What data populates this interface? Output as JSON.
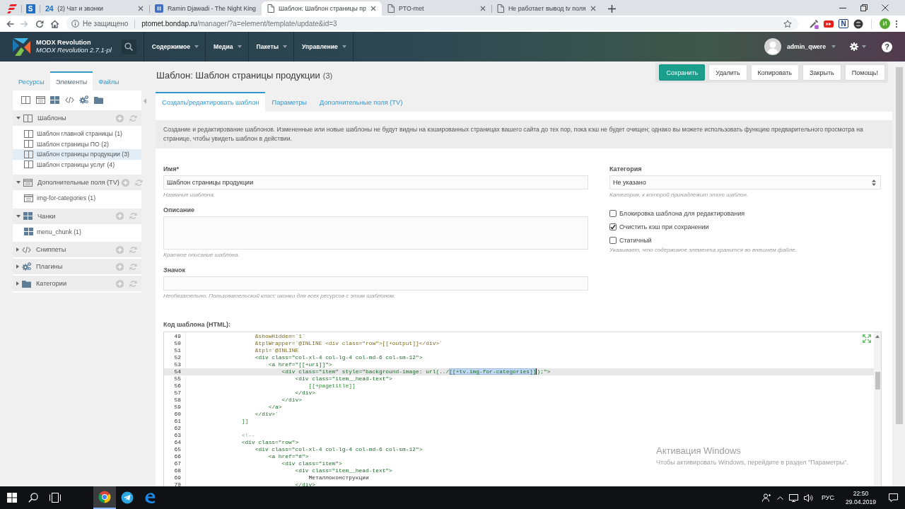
{
  "browser": {
    "tabs": [
      {
        "kind": "logo",
        "selected": false
      },
      {
        "kind": "letter",
        "icon_text": "S",
        "selected": false
      },
      {
        "kind": "counter",
        "icon_text": "24",
        "title": "(2) Чат и звонки",
        "selected": false
      },
      {
        "kind": "media",
        "title": "Ramin Djawadi - The Night King",
        "selected": false
      },
      {
        "kind": "page",
        "title": "Шаблон: Шаблон страницы пр",
        "selected": true
      },
      {
        "kind": "page",
        "title": "PTO-met",
        "selected": false
      },
      {
        "kind": "page",
        "title": "Не работает вывод tv поля",
        "selected": false
      }
    ],
    "security_label": "Не защищено",
    "url": "ptomet.bondap.ru/manager/?a=element/template/update&id=3",
    "extension_letter": "N",
    "profile_initial": "И"
  },
  "modx": {
    "brand": "MODX Revolution",
    "version": "MODX Revolution 2.7.1-pl",
    "menu": [
      "Содержимое",
      "Медиа",
      "Пакеты",
      "Управление"
    ],
    "user": "admin_qwere",
    "help": "?"
  },
  "sidebar": {
    "tabs": [
      {
        "label": "Ресурсы",
        "selected": false
      },
      {
        "label": "Элементы",
        "selected": true
      },
      {
        "label": "Файлы",
        "selected": false
      }
    ],
    "sections": [
      {
        "kind": "templates",
        "label": "Шаблоны",
        "expanded": true,
        "children": [
          {
            "label": "Шаблон главной страницы (1)",
            "selected": false
          },
          {
            "label": "Шаблон страницы ПО (2)",
            "selected": false
          },
          {
            "label": "Шаблон страницы продукции (3)",
            "selected": true
          },
          {
            "label": "Шаблон страницы услуг (4)",
            "selected": false
          }
        ]
      },
      {
        "kind": "tvs",
        "label": "Дополнительные поля (TV)",
        "expanded": true,
        "children": [
          {
            "label": "img-for-categories (1)",
            "selected": false
          }
        ]
      },
      {
        "kind": "chunks",
        "label": "Чанки",
        "expanded": true,
        "children": [
          {
            "label": "menu_chunk (1)",
            "selected": false
          }
        ]
      },
      {
        "kind": "snippets",
        "label": "Сниппеты",
        "expanded": false
      },
      {
        "kind": "plugins",
        "label": "Плагины",
        "expanded": false
      },
      {
        "kind": "categories",
        "label": "Категории",
        "expanded": false
      }
    ]
  },
  "page": {
    "title": "Шаблон: Шаблон страницы продукции",
    "count": "(3)",
    "actions": [
      {
        "kind": "primary",
        "label": "Сохранить"
      },
      {
        "kind": "default",
        "label": "Удалить"
      },
      {
        "kind": "default",
        "label": "Копировать"
      },
      {
        "kind": "default",
        "label": "Закрыть"
      },
      {
        "kind": "default",
        "label": "Помощь!"
      }
    ],
    "tabs": [
      {
        "label": "Создать/редактировать шаблон",
        "selected": true
      },
      {
        "label": "Параметры",
        "selected": false
      },
      {
        "label": "Дополнительные поля (TV)",
        "selected": false
      }
    ],
    "intro": "Создание и редактирование шаблонов. Измененные или новые шаблоны не будут видны на кэшированных страницах вашего сайта до тех пор, пока кэш не будет очищен; однако вы можете использовать функцию предварительного просмотра на странице, чтобы увидеть шаблон в действии.",
    "fields": [
      {
        "kind": "input",
        "label": "Имя*",
        "value": "Шаблон страницы продукции",
        "hint": "Название шаблона."
      },
      {
        "kind": "textarea",
        "label": "Описание",
        "hint": "Краткое описание шаблона."
      },
      {
        "kind": "input",
        "label": "Значок",
        "hint": "Необязательно. Пользовательский класс иконки для всех ресурсов с этим шаблоном."
      }
    ],
    "category": {
      "label": "Категория",
      "value": "Не указано",
      "hint": "Категория, к которой принадлежит этот шаблон."
    },
    "options": [
      {
        "label": "Блокировка шаблона для редактирования",
        "checked": false
      },
      {
        "label": "Очистить кэш при сохранении",
        "checked": true
      },
      {
        "label": "Статичный",
        "checked": false
      }
    ],
    "options_hint": "Указывает, что содержимое элемента хранится во внешнем файле.",
    "code": {
      "label": "Код шаблона (HTML):",
      "lines": [
        {
          "number": "49",
          "kind": "param",
          "text": "                    &showHidden=`1`",
          "active": false
        },
        {
          "number": "50",
          "kind": "param",
          "text": "                    &tplWrapper=`@INLINE <div class=\"row\">[[+output]]</div>`",
          "active": false
        },
        {
          "number": "51",
          "kind": "param",
          "text": "                    &tpl=`@INLINE",
          "active": false
        },
        {
          "number": "52",
          "kind": "tag",
          "text": "                    <div class=\"col-xl-4 col-lg-4 col-md-6 col-sm-12\">",
          "active": false
        },
        {
          "number": "53",
          "kind": "tag",
          "text": "                        <a href=\"[[+uri]]\">",
          "active": false
        },
        {
          "number": "54",
          "kind": "tag",
          "text": "                            <div class=\"item\" style=\"background-image: url(../",
          "selection": "[[+tv.img-for-categories]]",
          "text_after": ");\">",
          "active": true
        },
        {
          "number": "55",
          "kind": "tag",
          "text": "                                <div class=\"item__head-text\">",
          "active": false
        },
        {
          "number": "56",
          "kind": "placeholder",
          "text": "                                    [[+pagetitle]]",
          "active": false
        },
        {
          "number": "57",
          "kind": "tag",
          "text": "                                </div>",
          "active": false
        },
        {
          "number": "58",
          "kind": "tag",
          "text": "                            </div>",
          "active": false
        },
        {
          "number": "59",
          "kind": "tag",
          "text": "                        </a>",
          "active": false
        },
        {
          "number": "60",
          "kind": "tag",
          "text": "                    </div>`",
          "active": false
        },
        {
          "number": "61",
          "kind": "placeholder",
          "text": "                ]]",
          "active": false
        },
        {
          "number": "62",
          "kind": "text",
          "active": false
        },
        {
          "number": "63",
          "kind": "comment",
          "text": "                <!--",
          "active": false
        },
        {
          "number": "64",
          "kind": "tag",
          "text": "                <div class=\"row\">",
          "active": false
        },
        {
          "number": "65",
          "kind": "tag",
          "text": "                    <div class=\"col-xl-4 col-lg-4 col-md-6 col-sm-12\">",
          "active": false
        },
        {
          "number": "66",
          "kind": "tag",
          "text": "                        <a href=\"#\">",
          "active": false
        },
        {
          "number": "67",
          "kind": "tag",
          "text": "                            <div class=\"item\">",
          "active": false
        },
        {
          "number": "68",
          "kind": "tag",
          "text": "                                <div class=\"item__head-text\">",
          "active": false
        },
        {
          "number": "69",
          "kind": "text",
          "text": "                                    Металлоконструкции",
          "active": false
        },
        {
          "number": "70",
          "kind": "tag",
          "text": "                                </div>",
          "active": false
        }
      ]
    }
  },
  "activation_notice": {
    "title": "Активация Windows",
    "text": "Чтобы активировать Windows, перейдите в раздел \"Параметры\"."
  },
  "taskbar": {
    "apps": [
      {
        "kind": "wheel",
        "selected": true
      },
      {
        "kind": "plane",
        "selected": false
      },
      {
        "kind": "swirl",
        "selected": false
      }
    ],
    "language": "РУС",
    "time": "22:50",
    "date": "29.04.2019"
  }
}
